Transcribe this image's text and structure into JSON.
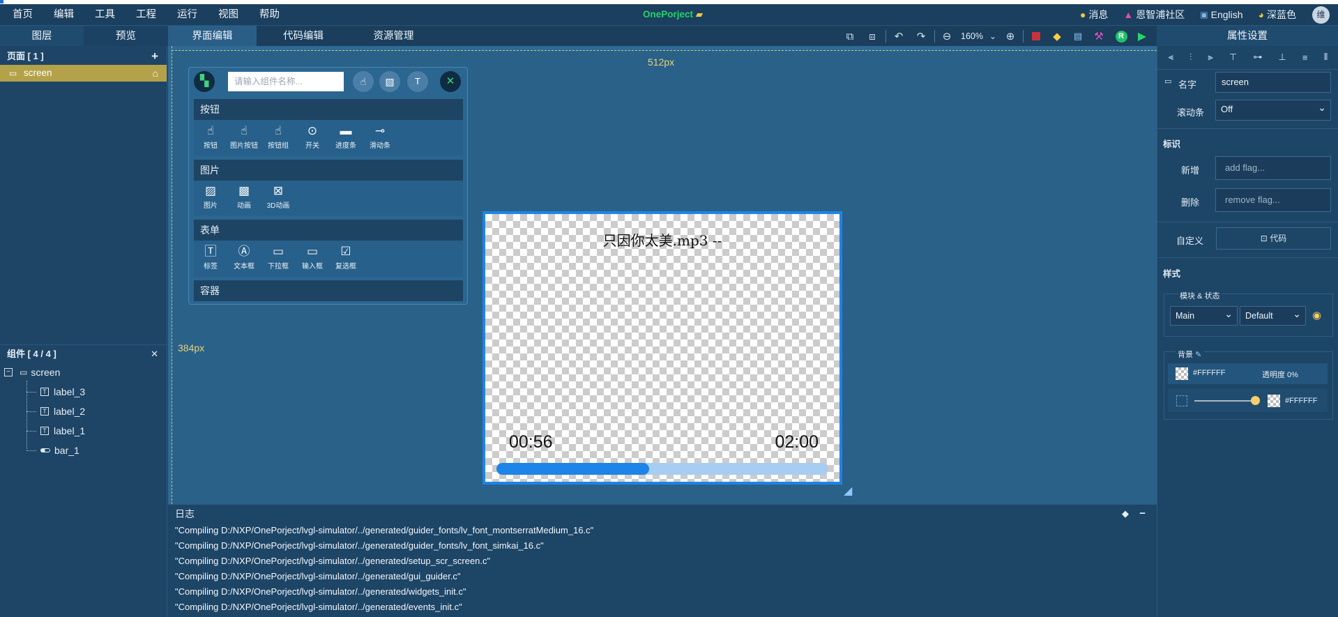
{
  "menu": [
    "首页",
    "编辑",
    "工具",
    "工程",
    "运行",
    "视图",
    "帮助"
  ],
  "brand": "OnePorject",
  "right_menu": {
    "messages": "消息",
    "community": "恩智浦社区",
    "language": "English",
    "theme": "深蓝色",
    "avatar": "维"
  },
  "tabs": {
    "layers": "图层",
    "preview": "预览",
    "ui_edit": "界面编辑",
    "code_edit": "代码编辑",
    "resources": "资源管理",
    "properties": "属性设置"
  },
  "toolbar": {
    "zoom": "160%"
  },
  "pages": {
    "header": "页面 [ 1 ]",
    "items": [
      "screen"
    ]
  },
  "components": {
    "header": "组件 [ 4 / 4 ]",
    "root": "screen",
    "children": [
      "label_3",
      "label_2",
      "label_1",
      "bar_1"
    ]
  },
  "canvas": {
    "width_label": "512px",
    "height_label": "384px"
  },
  "palette": {
    "search_placeholder": "请输入组件名称...",
    "sections": [
      {
        "title": "按钮",
        "items": [
          {
            "label": "按钮",
            "icon": "button-icon"
          },
          {
            "label": "图片按钮",
            "icon": "image-button-icon"
          },
          {
            "label": "按钮组",
            "icon": "button-group-icon"
          },
          {
            "label": "开关",
            "icon": "switch-icon"
          },
          {
            "label": "进度条",
            "icon": "progress-bar-icon"
          },
          {
            "label": "滑动条",
            "icon": "slider-icon"
          }
        ]
      },
      {
        "title": "图片",
        "items": [
          {
            "label": "图片",
            "icon": "image-icon"
          },
          {
            "label": "动画",
            "icon": "animation-icon"
          },
          {
            "label": "3D动画",
            "icon": "3d-animation-icon"
          }
        ]
      },
      {
        "title": "表单",
        "items": [
          {
            "label": "标签",
            "icon": "label-icon"
          },
          {
            "label": "文本框",
            "icon": "textarea-icon"
          },
          {
            "label": "下拉框",
            "icon": "dropdown-icon"
          },
          {
            "label": "输入框",
            "icon": "input-icon"
          },
          {
            "label": "复选框",
            "icon": "checkbox-icon"
          }
        ]
      },
      {
        "title": "容器",
        "items": []
      }
    ]
  },
  "screen_preview": {
    "title": "只因你太美.mp3 --",
    "time_elapsed": "00:56",
    "time_total": "02:00",
    "progress": 0.46
  },
  "log": {
    "title": "日志",
    "lines": [
      "\"Compiling D:/NXP/OnePorject/lvgl-simulator/../generated/guider_fonts/lv_font_montserratMedium_16.c\"",
      "\"Compiling D:/NXP/OnePorject/lvgl-simulator/../generated/guider_fonts/lv_font_simkai_16.c\"",
      "\"Compiling D:/NXP/OnePorject/lvgl-simulator/../generated/setup_scr_screen.c\"",
      "\"Compiling D:/NXP/OnePorject/lvgl-simulator/../generated/gui_guider.c\"",
      "\"Compiling D:/NXP/OnePorject/lvgl-simulator/../generated/widgets_init.c\"",
      "\"Compiling D:/NXP/OnePorject/lvgl-simulator/../generated/events_init.c\""
    ]
  },
  "properties": {
    "name_label": "名字",
    "name_value": "screen",
    "scrollbar_label": "滚动条",
    "scrollbar_value": "Off",
    "flag_section": "标识",
    "add_label": "新增",
    "add_placeholder": "add flag...",
    "remove_label": "删除",
    "remove_placeholder": "remove flag...",
    "custom_label": "自定义",
    "code_button": "代码",
    "style_section": "样式",
    "part_state_label": "模块 & 状态",
    "part_value": "Main",
    "state_value": "Default",
    "background_label": "背景",
    "bg_color": "#FFFFFF",
    "opacity_label": "透明度 0%",
    "bg_grad_color": "#FFFFFF"
  },
  "colors": {
    "accent": "#1f84e6",
    "brand": "#23d36b",
    "ruler_text": "#e8d27a",
    "highlight": "#b3a24a"
  }
}
